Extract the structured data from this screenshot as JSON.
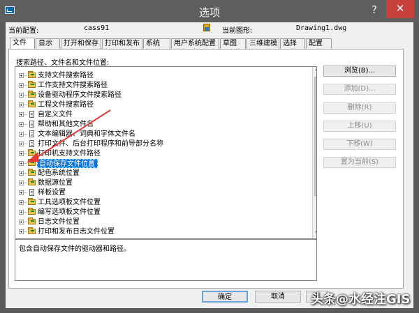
{
  "window": {
    "title": "选项",
    "help_icon": "?",
    "close_icon": "✕"
  },
  "config": {
    "current_config_label": "当前配置:",
    "current_config_value": "cass91",
    "current_drawing_label": "当前图形:",
    "current_drawing_value": "Drawing1.dwg"
  },
  "tabs": [
    {
      "label": "文件",
      "active": true
    },
    {
      "label": "显示"
    },
    {
      "label": "打开和保存"
    },
    {
      "label": "打印和发布"
    },
    {
      "label": "系统"
    },
    {
      "label": "用户系统配置"
    },
    {
      "label": "草图"
    },
    {
      "label": "三维建模"
    },
    {
      "label": "选择"
    },
    {
      "label": "配置"
    }
  ],
  "files": {
    "section_label": "搜索路径、文件名和文件位置:",
    "tree_items": [
      {
        "label": "支持文件搜索路径",
        "icon": "folder-icon"
      },
      {
        "label": "工作支持文件搜索路径",
        "icon": "folder-icon"
      },
      {
        "label": "设备驱动程序文件搜索路径",
        "icon": "folder-icon"
      },
      {
        "label": "工程文件搜索路径",
        "icon": "folder-icon"
      },
      {
        "label": "自定义文件",
        "icon": "file-icon"
      },
      {
        "label": "帮助和其他文件名",
        "icon": "file-icon"
      },
      {
        "label": "文本编辑器、词典和字体文件名",
        "icon": "file-icon"
      },
      {
        "label": "打印文件、后台打印程序和前导部分名称",
        "icon": "file-icon"
      },
      {
        "label": "打印机支持文件路径",
        "icon": "folder-icon"
      },
      {
        "label": "自动保存文件位置",
        "icon": "folder-icon",
        "selected": true
      },
      {
        "label": "配色系统位置",
        "icon": "folder-icon"
      },
      {
        "label": "数据源位置",
        "icon": "folder-icon"
      },
      {
        "label": "样板设置",
        "icon": "file-icon"
      },
      {
        "label": "工具选项板文件位置",
        "icon": "folder-icon"
      },
      {
        "label": "编写选项板文件位置",
        "icon": "folder-icon"
      },
      {
        "label": "日志文件位置",
        "icon": "folder-icon"
      },
      {
        "label": "打印和发布日志文件位置",
        "icon": "folder-icon"
      }
    ],
    "description": "包含自动保存文件的驱动器和路径。"
  },
  "side_buttons": [
    {
      "label": "浏览(B)...",
      "state": "enabled"
    },
    {
      "label": "添加(D)...",
      "state": "disabled"
    },
    {
      "label": "删除(R)",
      "state": "disabled"
    },
    {
      "label": "上移(U)",
      "state": "disabled"
    },
    {
      "label": "下移(W)",
      "state": "disabled"
    },
    {
      "label": "置为当前(S)",
      "state": "disabled"
    }
  ],
  "dialog_buttons": {
    "ok": "确定",
    "cancel": "取消",
    "apply_visible": "应"
  },
  "watermark": {
    "text": "头条@水经注GIS"
  },
  "colors": {
    "title_bar": "#5e5e5e",
    "close_button": "#c7423a",
    "selection": "#0a74d8",
    "annotation_arrow": "#e53935"
  }
}
